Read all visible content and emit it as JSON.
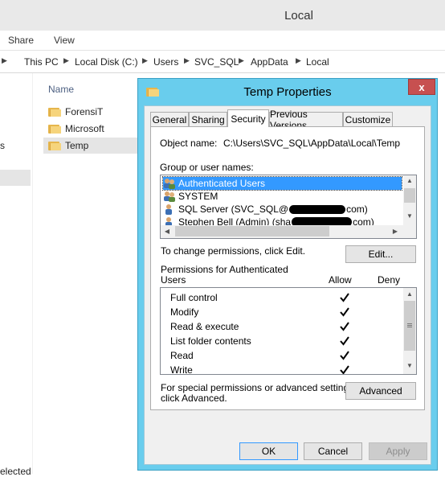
{
  "explorer": {
    "title": "Local",
    "ribbon": {
      "share": "Share",
      "view": "View"
    },
    "breadcrumb": [
      "This PC",
      "Local Disk (C:)",
      "Users",
      "SVC_SQL",
      "AppData",
      "Local"
    ],
    "column_name": "Name",
    "files": [
      "ForensiT",
      "Microsoft",
      "Temp"
    ],
    "nav_partial": "s",
    "status_partial": "elected"
  },
  "dialog": {
    "title": "Temp Properties",
    "close": "x",
    "tabs": [
      "General",
      "Sharing",
      "Security",
      "Previous Versions",
      "Customize"
    ],
    "active_tab": "Security",
    "object_name_label": "Object name:",
    "object_name_value": "C:\\Users\\SVC_SQL\\AppData\\Local\\Temp",
    "group_label": "Group or user names:",
    "users": [
      {
        "name": "Authenticated Users",
        "selected": true,
        "icon": "group-icon"
      },
      {
        "name": "SYSTEM",
        "selected": false,
        "icon": "group-icon"
      },
      {
        "name": "SQL Server (SVC_SQL@",
        "suffix": "com)",
        "selected": false,
        "icon": "user-icon"
      },
      {
        "name": "Stephen Bell (Admin) (sha",
        "suffix": "com)",
        "selected": false,
        "icon": "user-icon"
      }
    ],
    "change_perm_text": "To change permissions, click Edit.",
    "edit_button": "Edit...",
    "perm_header_1": "Permissions for Authenticated",
    "perm_header_2": "Users",
    "allow_label": "Allow",
    "deny_label": "Deny",
    "permissions": [
      {
        "name": "Full control",
        "allow": true
      },
      {
        "name": "Modify",
        "allow": true
      },
      {
        "name": "Read & execute",
        "allow": true
      },
      {
        "name": "List folder contents",
        "allow": true
      },
      {
        "name": "Read",
        "allow": true
      },
      {
        "name": "Write",
        "allow": true
      }
    ],
    "special_text_1": "For special permissions or advanced settings,",
    "special_text_2": "click Advanced.",
    "advanced_button": "Advanced",
    "ok_button": "OK",
    "cancel_button": "Cancel",
    "apply_button": "Apply"
  },
  "colors": {
    "dialog_frame": "#69cded",
    "close_button": "#c75050",
    "selection": "#3399ff"
  }
}
